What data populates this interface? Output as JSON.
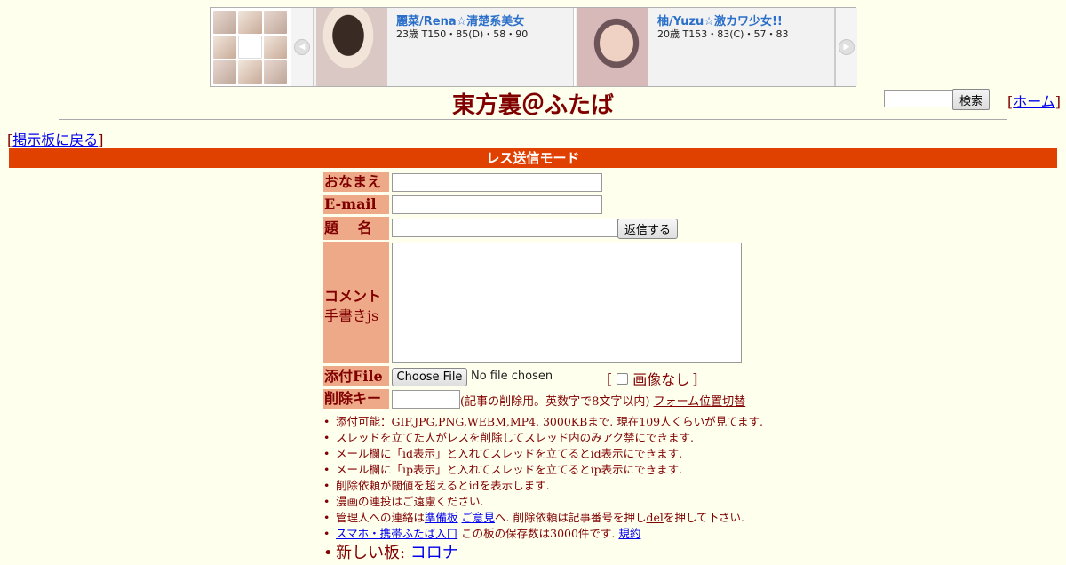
{
  "banner": {
    "cards": [
      {
        "name": "麗菜/Rena☆清楚系美女",
        "spec": "23歳 T150・85(D)・58・90"
      },
      {
        "name": "柚/Yuzu☆激カワ少女!!",
        "spec": "20歳 T153・83(C)・57・83"
      }
    ],
    "arrow_left": "◀",
    "arrow_right": "▶"
  },
  "header": {
    "title": "東方裏＠ふたば",
    "search_button": "検索",
    "home_link": "ホーム",
    "back_link": "掲示板に戻る",
    "bracket_open": "[",
    "bracket_close": "]"
  },
  "mode": "レス送信モード",
  "form": {
    "name_label": "おなまえ",
    "email_label": "E-mail",
    "subject_label": "題　 名",
    "submit_button": "返信する",
    "comment_label": "コメント",
    "handwrite_link": "手書きjs",
    "file_label": "添付File",
    "file_button": "Choose File",
    "file_status": "No file chosen",
    "no_image": "画像なし",
    "delkey_label": "削除キー",
    "delkey_note": "(記事の削除用。英数字で8文字以内)",
    "form_toggle": "フォーム位置切替"
  },
  "notes": {
    "n1": "添付可能：GIF,JPG,PNG,WEBM,MP4. 3000KBまで. 現在109人くらいが見てます.",
    "n2": "スレッドを立てた人がレスを削除してスレッド内のみアク禁にできます.",
    "n3": "メール欄に「id表示」と入れてスレッドを立てるとid表示にできます.",
    "n4": "メール欄に「ip表示」と入れてスレッドを立てるとip表示にできます.",
    "n5": "削除依頼が閾値を超えるとidを表示します.",
    "n6": "漫画の連投はご遠慮ください.",
    "n7_pre": "管理人への連絡は",
    "n7_link1": "準備板",
    "n7_link2": "ご意見",
    "n7_mid": "へ. 削除依頼は記事番号を押し",
    "n7_del": "del",
    "n7_post": "を押して下さい.",
    "n8_link": "スマホ・携帯ふたば入口",
    "n8_mid": " この板の保存数は3000件です. ",
    "n8_rules": "規約",
    "n9_pre": "新しい板: ",
    "n9_link": "コロナ"
  }
}
